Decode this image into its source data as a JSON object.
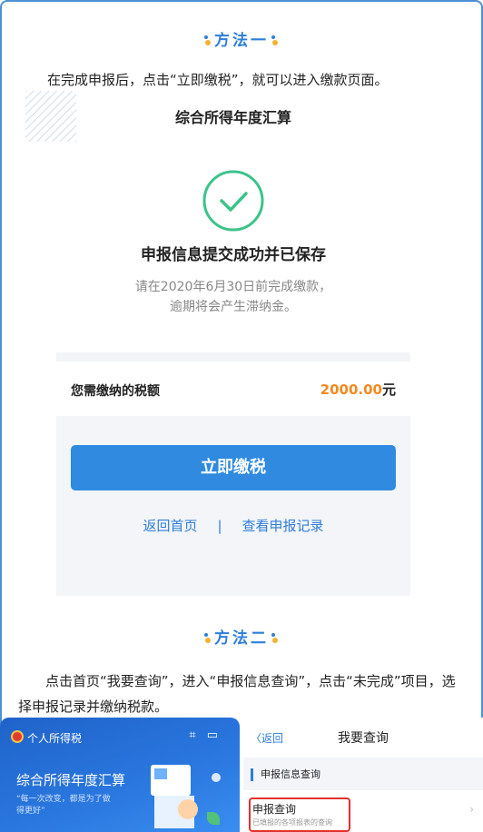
{
  "method1": {
    "title": "方法一"
  },
  "method1_text": "在完成申报后，点击“立即缴税”，就可以进入缴款页面。",
  "screen1": {
    "title": "综合所得年度汇算",
    "success": "申报信息提交成功并已保存",
    "hint_line1": "请在2020年6月30日前完成缴款，",
    "hint_line2": "逾期将会产生滞纳金。",
    "tax_label": "您需缴纳的税额",
    "tax_amount": "2000.00",
    "tax_unit": "元",
    "pay_button": "立即缴税",
    "link_home": "返回首页",
    "link_sep": "|",
    "link_records": "查看申报记录",
    "accent": "#2f8ae0",
    "success_color": "#3cc38a",
    "amount_color": "#f28a20"
  },
  "method2": {
    "title": "方法二"
  },
  "method2_text": "点击首页“我要查询”，进入“申报信息查询”，点击“未完成”项目，选择申报记录并缴纳税款。",
  "screen2": {
    "app_name": "个人所得税",
    "annual_title": "综合所得年度汇算",
    "slogan": "“每一次改变，都是为了做得更好”"
  },
  "screen3": {
    "back": "〈返回",
    "nav_title": "我要查询",
    "section": "申报信息查询",
    "query_title": "申报查询",
    "query_desc": "已填报的各项报表的查询",
    "highlight_color": "#e2312b"
  }
}
